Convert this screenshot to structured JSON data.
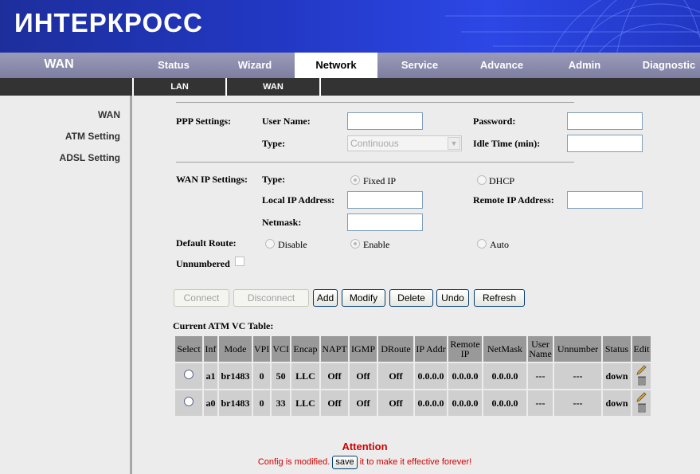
{
  "banner": {
    "logo": "ИНТЕРКРОСС"
  },
  "nav": {
    "section": "WAN",
    "tabs": [
      "Status",
      "Wizard",
      "Network",
      "Service",
      "Advance",
      "Admin",
      "Diagnostic"
    ],
    "active": "Network"
  },
  "subnav": [
    "LAN",
    "WAN"
  ],
  "sidebar": [
    "WAN",
    "ATM Setting",
    "ADSL Setting"
  ],
  "ppp": {
    "label": "PPP Settings:",
    "username_label": "User Name:",
    "password_label": "Password:",
    "type_label": "Type:",
    "type_value": "Continuous",
    "idle_label": "Idle Time (min):"
  },
  "wanip": {
    "label": "WAN IP Settings:",
    "type_label": "Type:",
    "fixed": "Fixed IP",
    "dhcp": "DHCP",
    "local_label": "Local IP Address:",
    "remote_label": "Remote IP Address:",
    "netmask_label": "Netmask:"
  },
  "default_route": {
    "label": "Default Route:",
    "disable": "Disable",
    "enable": "Enable",
    "auto": "Auto"
  },
  "unnumbered": "Unnumbered",
  "buttons": {
    "connect": "Connect",
    "disconnect": "Disconnect",
    "add": "Add",
    "modify": "Modify",
    "delete": "Delete",
    "undo": "Undo",
    "refresh": "Refresh"
  },
  "table": {
    "title": "Current ATM VC Table:",
    "headers": [
      "Select",
      "Inf",
      "Mode",
      "VPI",
      "VCI",
      "Encap",
      "NAPT",
      "IGMP",
      "DRoute",
      "IP Addr",
      "Remote IP",
      "NetMask",
      "User Name",
      "Unnumber",
      "Status",
      "Edit"
    ],
    "rows": [
      [
        "a1",
        "br1483",
        "0",
        "50",
        "LLC",
        "Off",
        "Off",
        "Off",
        "0.0.0.0",
        "0.0.0.0",
        "0.0.0.0",
        "---",
        "---",
        "down"
      ],
      [
        "a0",
        "br1483",
        "0",
        "33",
        "LLC",
        "Off",
        "Off",
        "Off",
        "0.0.0.0",
        "0.0.0.0",
        "0.0.0.0",
        "---",
        "---",
        "down"
      ]
    ]
  },
  "attention": {
    "title": "Attention",
    "pre": "Config is modified.",
    "save": "save",
    "post": "it to make it effective forever!"
  },
  "colors": {
    "banner": "#2238c4",
    "nav": "#8c8cac",
    "subnav": "#333333",
    "attention": "#d00000"
  }
}
